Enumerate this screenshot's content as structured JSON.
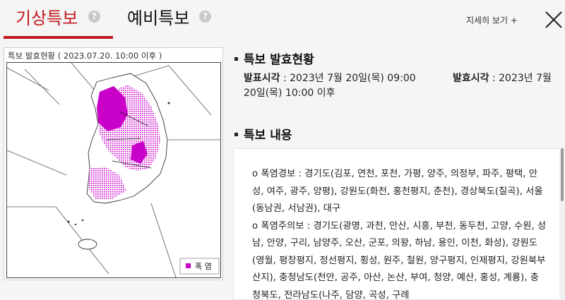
{
  "tabs": {
    "weather_warning": "기상특보",
    "pre_warning": "예비특보",
    "help": "?"
  },
  "header": {
    "detail_link": "지세히 보기 +"
  },
  "map": {
    "title": "특보 발효현황 ( 2023.07.20.  10:00 이후 )",
    "legend_label": "폭 염",
    "legend_color": "#c800c8"
  },
  "status": {
    "section_title": "특보 발효현황",
    "announce_label": "발표시각",
    "announce_value": " : 2023년 7월 20일(목) 09:00",
    "effective_label": "발효시각",
    "effective_value_1": " : 2023년 7월",
    "effective_value_2": "20일(목) 10:00 이후"
  },
  "content": {
    "section_title": "특보 내용",
    "text": "o 폭염경보 : 경기도(김포, 연천, 포천, 가평, 양주, 의정부, 파주, 평택, 안성, 여주, 광주, 양평), 강원도(화천, 홍천평지, 춘천), 경상북도(칠곡), 서울(동남권, 서남권), 대구\no 폭염주의보 : 경기도(광명, 과천, 안산, 시흥, 부천, 동두천, 고양, 수원, 성남, 안양, 구리, 남양주, 오산, 군포, 의왕, 하남, 용인, 이천, 화성), 강원도(영월, 평창평지, 정선평지, 횡성, 원주, 철원, 양구평지, 인제평지, 강원북부산지), 충청남도(천안, 공주, 아산, 논산, 부여, 청양, 예산, 홍성, 계룡), 충청북도, 전라남도(나주, 담양, 곡성, 구례"
  }
}
